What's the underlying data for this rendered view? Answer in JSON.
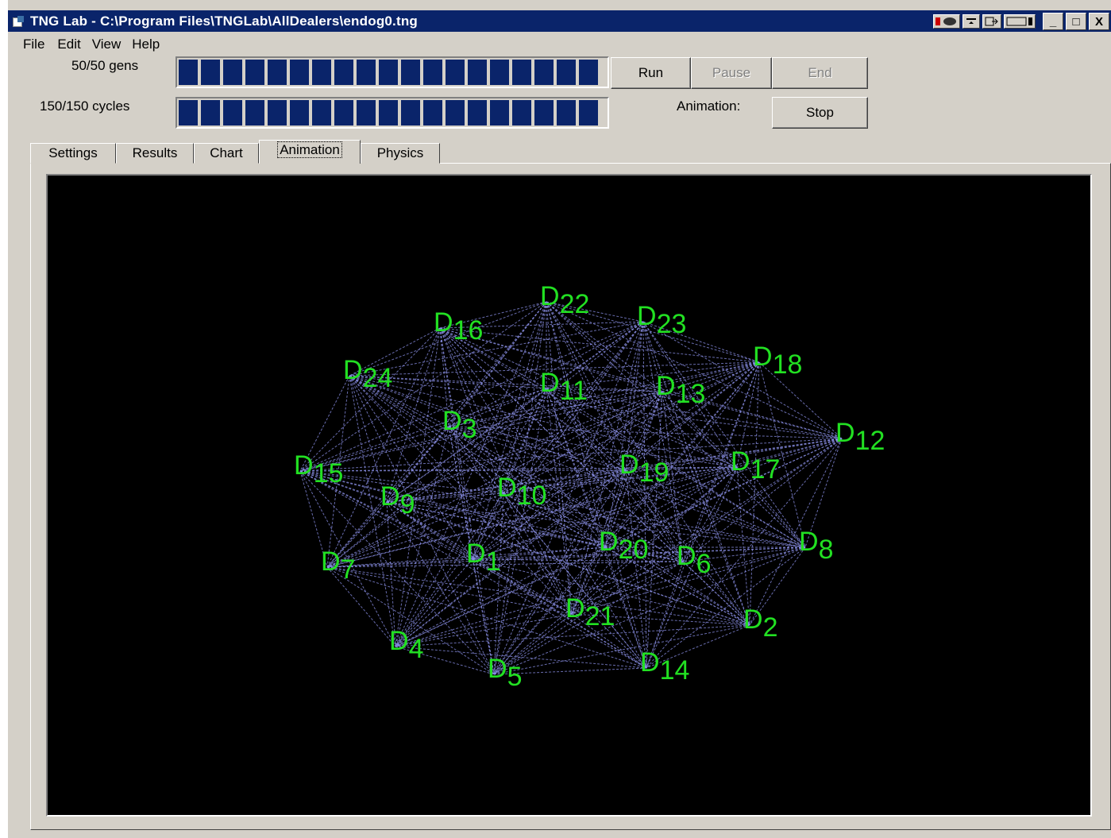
{
  "window": {
    "title": "TNG Lab - C:\\Program Files\\TNGLab\\AllDealers\\endog0.tng",
    "controls": {
      "minimize": "_",
      "maximize": "□",
      "close": "X"
    }
  },
  "menu": [
    "File",
    "Edit",
    "View",
    "Help"
  ],
  "gens": {
    "label": "50/50 gens",
    "progress": 1.0
  },
  "cycles": {
    "label": "150/150 cycles",
    "progress": 1.0
  },
  "buttons": {
    "run": "Run",
    "pause": "Pause",
    "end": "End",
    "stop": "Stop"
  },
  "animation_label": "Animation:",
  "tabs": [
    {
      "label": "Settings"
    },
    {
      "label": "Results"
    },
    {
      "label": "Chart"
    },
    {
      "label": "Animation",
      "active": true
    },
    {
      "label": "Physics"
    }
  ],
  "colors": {
    "titlebar": "#0a246a",
    "progress_block": "#0a246a",
    "node_label": "#22e022",
    "edge": "#8a8fe6",
    "canvas_bg": "#000000"
  },
  "network": {
    "nodes": [
      {
        "id": "D22",
        "num": "22"
      },
      {
        "id": "D23",
        "num": "23"
      },
      {
        "id": "D16",
        "num": "16"
      },
      {
        "id": "D18",
        "num": "18"
      },
      {
        "id": "D24",
        "num": "24"
      },
      {
        "id": "D11",
        "num": "11"
      },
      {
        "id": "D13",
        "num": "13"
      },
      {
        "id": "D3",
        "num": "3"
      },
      {
        "id": "D12",
        "num": "12"
      },
      {
        "id": "D15",
        "num": "15"
      },
      {
        "id": "D19",
        "num": "19"
      },
      {
        "id": "D17",
        "num": "17"
      },
      {
        "id": "D10",
        "num": "10"
      },
      {
        "id": "D9",
        "num": "9"
      },
      {
        "id": "D8",
        "num": "8"
      },
      {
        "id": "D20",
        "num": "20"
      },
      {
        "id": "D6",
        "num": "6"
      },
      {
        "id": "D7",
        "num": "7"
      },
      {
        "id": "D1",
        "num": "1"
      },
      {
        "id": "D21",
        "num": "21"
      },
      {
        "id": "D2",
        "num": "2"
      },
      {
        "id": "D4",
        "num": "4"
      },
      {
        "id": "D14",
        "num": "14"
      },
      {
        "id": "D5",
        "num": "5"
      }
    ],
    "fully_connected": true
  }
}
